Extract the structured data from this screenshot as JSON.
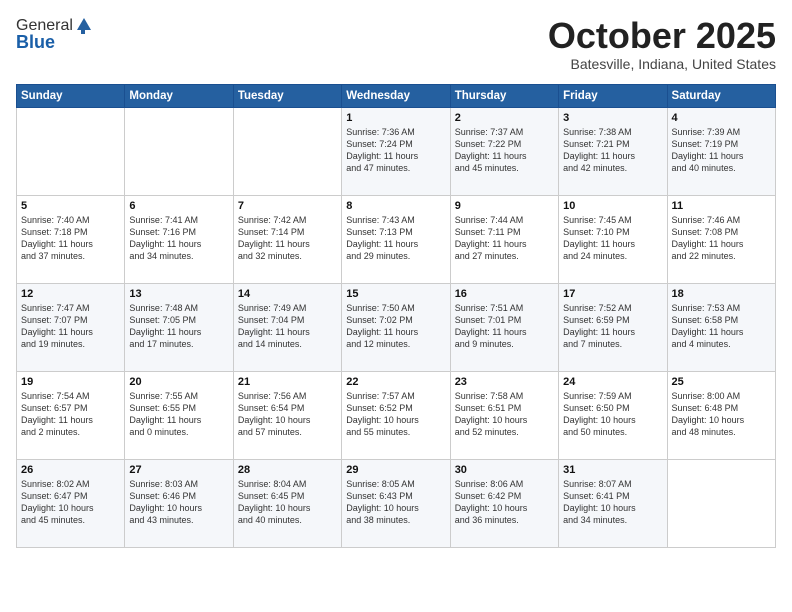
{
  "header": {
    "logo_general": "General",
    "logo_blue": "Blue",
    "month_title": "October 2025",
    "location": "Batesville, Indiana, United States"
  },
  "days_of_week": [
    "Sunday",
    "Monday",
    "Tuesday",
    "Wednesday",
    "Thursday",
    "Friday",
    "Saturday"
  ],
  "weeks": [
    [
      {
        "day": "",
        "info": ""
      },
      {
        "day": "",
        "info": ""
      },
      {
        "day": "",
        "info": ""
      },
      {
        "day": "1",
        "info": "Sunrise: 7:36 AM\nSunset: 7:24 PM\nDaylight: 11 hours\nand 47 minutes."
      },
      {
        "day": "2",
        "info": "Sunrise: 7:37 AM\nSunset: 7:22 PM\nDaylight: 11 hours\nand 45 minutes."
      },
      {
        "day": "3",
        "info": "Sunrise: 7:38 AM\nSunset: 7:21 PM\nDaylight: 11 hours\nand 42 minutes."
      },
      {
        "day": "4",
        "info": "Sunrise: 7:39 AM\nSunset: 7:19 PM\nDaylight: 11 hours\nand 40 minutes."
      }
    ],
    [
      {
        "day": "5",
        "info": "Sunrise: 7:40 AM\nSunset: 7:18 PM\nDaylight: 11 hours\nand 37 minutes."
      },
      {
        "day": "6",
        "info": "Sunrise: 7:41 AM\nSunset: 7:16 PM\nDaylight: 11 hours\nand 34 minutes."
      },
      {
        "day": "7",
        "info": "Sunrise: 7:42 AM\nSunset: 7:14 PM\nDaylight: 11 hours\nand 32 minutes."
      },
      {
        "day": "8",
        "info": "Sunrise: 7:43 AM\nSunset: 7:13 PM\nDaylight: 11 hours\nand 29 minutes."
      },
      {
        "day": "9",
        "info": "Sunrise: 7:44 AM\nSunset: 7:11 PM\nDaylight: 11 hours\nand 27 minutes."
      },
      {
        "day": "10",
        "info": "Sunrise: 7:45 AM\nSunset: 7:10 PM\nDaylight: 11 hours\nand 24 minutes."
      },
      {
        "day": "11",
        "info": "Sunrise: 7:46 AM\nSunset: 7:08 PM\nDaylight: 11 hours\nand 22 minutes."
      }
    ],
    [
      {
        "day": "12",
        "info": "Sunrise: 7:47 AM\nSunset: 7:07 PM\nDaylight: 11 hours\nand 19 minutes."
      },
      {
        "day": "13",
        "info": "Sunrise: 7:48 AM\nSunset: 7:05 PM\nDaylight: 11 hours\nand 17 minutes."
      },
      {
        "day": "14",
        "info": "Sunrise: 7:49 AM\nSunset: 7:04 PM\nDaylight: 11 hours\nand 14 minutes."
      },
      {
        "day": "15",
        "info": "Sunrise: 7:50 AM\nSunset: 7:02 PM\nDaylight: 11 hours\nand 12 minutes."
      },
      {
        "day": "16",
        "info": "Sunrise: 7:51 AM\nSunset: 7:01 PM\nDaylight: 11 hours\nand 9 minutes."
      },
      {
        "day": "17",
        "info": "Sunrise: 7:52 AM\nSunset: 6:59 PM\nDaylight: 11 hours\nand 7 minutes."
      },
      {
        "day": "18",
        "info": "Sunrise: 7:53 AM\nSunset: 6:58 PM\nDaylight: 11 hours\nand 4 minutes."
      }
    ],
    [
      {
        "day": "19",
        "info": "Sunrise: 7:54 AM\nSunset: 6:57 PM\nDaylight: 11 hours\nand 2 minutes."
      },
      {
        "day": "20",
        "info": "Sunrise: 7:55 AM\nSunset: 6:55 PM\nDaylight: 11 hours\nand 0 minutes."
      },
      {
        "day": "21",
        "info": "Sunrise: 7:56 AM\nSunset: 6:54 PM\nDaylight: 10 hours\nand 57 minutes."
      },
      {
        "day": "22",
        "info": "Sunrise: 7:57 AM\nSunset: 6:52 PM\nDaylight: 10 hours\nand 55 minutes."
      },
      {
        "day": "23",
        "info": "Sunrise: 7:58 AM\nSunset: 6:51 PM\nDaylight: 10 hours\nand 52 minutes."
      },
      {
        "day": "24",
        "info": "Sunrise: 7:59 AM\nSunset: 6:50 PM\nDaylight: 10 hours\nand 50 minutes."
      },
      {
        "day": "25",
        "info": "Sunrise: 8:00 AM\nSunset: 6:48 PM\nDaylight: 10 hours\nand 48 minutes."
      }
    ],
    [
      {
        "day": "26",
        "info": "Sunrise: 8:02 AM\nSunset: 6:47 PM\nDaylight: 10 hours\nand 45 minutes."
      },
      {
        "day": "27",
        "info": "Sunrise: 8:03 AM\nSunset: 6:46 PM\nDaylight: 10 hours\nand 43 minutes."
      },
      {
        "day": "28",
        "info": "Sunrise: 8:04 AM\nSunset: 6:45 PM\nDaylight: 10 hours\nand 40 minutes."
      },
      {
        "day": "29",
        "info": "Sunrise: 8:05 AM\nSunset: 6:43 PM\nDaylight: 10 hours\nand 38 minutes."
      },
      {
        "day": "30",
        "info": "Sunrise: 8:06 AM\nSunset: 6:42 PM\nDaylight: 10 hours\nand 36 minutes."
      },
      {
        "day": "31",
        "info": "Sunrise: 8:07 AM\nSunset: 6:41 PM\nDaylight: 10 hours\nand 34 minutes."
      },
      {
        "day": "",
        "info": ""
      }
    ]
  ]
}
